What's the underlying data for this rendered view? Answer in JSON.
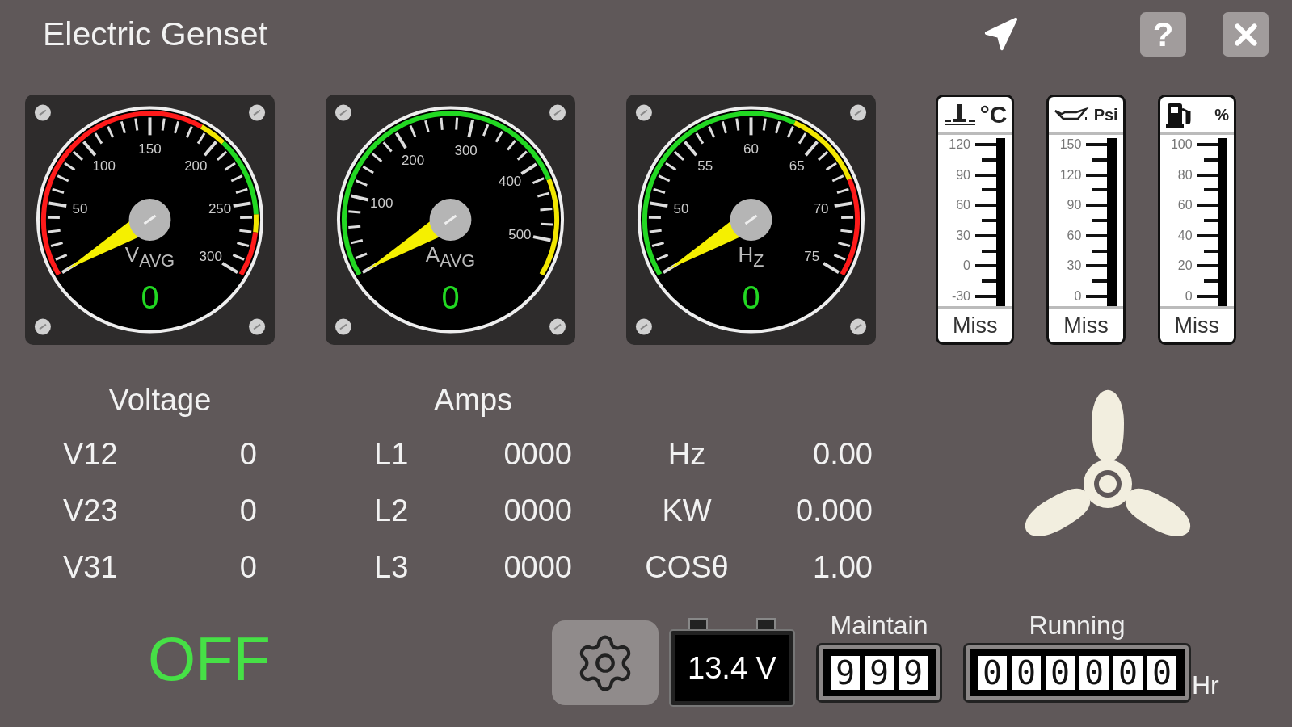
{
  "window": {
    "title": "Electric Genset"
  },
  "toolbar": {
    "help": "?"
  },
  "gauges": [
    {
      "kind": "voltage",
      "label": "V$_{AVG}$",
      "reading": "0",
      "scale": [
        "50",
        "100",
        "150",
        "200",
        "250",
        "300"
      ]
    },
    {
      "kind": "amps",
      "label": "A$_{AVG}$",
      "reading": "0",
      "scale": [
        "100",
        "200",
        "300",
        "400",
        "500"
      ]
    },
    {
      "kind": "frequency",
      "label": "H$_{Z}$",
      "reading": "0",
      "scale": [
        "50",
        "55",
        "60",
        "65",
        "70",
        "75"
      ]
    }
  ],
  "meters": [
    {
      "kind": "temperature",
      "unit": "°C",
      "scale": [
        "120",
        "90",
        "60",
        "30",
        "0",
        "-30"
      ],
      "reading": "Miss"
    },
    {
      "kind": "oil",
      "unit": "Psi",
      "scale": [
        "150",
        "120",
        "90",
        "60",
        "30",
        "0"
      ],
      "reading": "Miss"
    },
    {
      "kind": "fuel",
      "unit": "%",
      "scale": [
        "100",
        "80",
        "60",
        "40",
        "20",
        "0"
      ],
      "reading": "Miss"
    }
  ],
  "stats": [
    {
      "header": "Voltage",
      "rows": [
        {
          "label": "V12",
          "value": "0"
        },
        {
          "label": "V23",
          "value": "0"
        },
        {
          "label": "V31",
          "value": "0"
        }
      ]
    },
    {
      "header": "Amps",
      "rows": [
        {
          "label": "L1",
          "value": "0000"
        },
        {
          "label": "L2",
          "value": "0000"
        },
        {
          "label": "L3",
          "value": "0000"
        }
      ]
    },
    {
      "rows": [
        {
          "label": "Hz",
          "value": "0.00"
        },
        {
          "label": "KW",
          "value": "0.000"
        },
        {
          "label": "COSθ",
          "value": "1.00"
        }
      ]
    }
  ],
  "status": "OFF",
  "battery": "13.4 V",
  "maintain": {
    "label": "Maintain",
    "digits": [
      "9",
      "9",
      "9"
    ]
  },
  "running": {
    "label": "Running",
    "digits": [
      "0",
      "0",
      "0",
      "0",
      "0",
      "0"
    ],
    "unit": "Hr"
  }
}
